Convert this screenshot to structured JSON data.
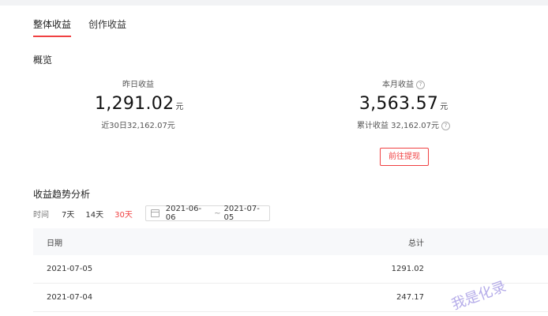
{
  "tabs": [
    {
      "label": "整体收益",
      "active": true
    },
    {
      "label": "创作收益",
      "active": false
    }
  ],
  "overview": {
    "title": "概览",
    "yesterday": {
      "label": "昨日收益",
      "value": "1,291.02",
      "unit": "元",
      "sub": "近30日32,162.07元"
    },
    "month": {
      "label": "本月收益",
      "value": "3,563.57",
      "unit": "元",
      "sub": "累计收益 32,162.07元",
      "help_icon": "question-circle-icon"
    },
    "withdraw_button": "前往提现"
  },
  "trend": {
    "title": "收益趋势分析",
    "time_label": "时间",
    "options": [
      {
        "label": "7天",
        "active": false
      },
      {
        "label": "14天",
        "active": false
      },
      {
        "label": "30天",
        "active": true
      }
    ],
    "date_start": "2021-06-06",
    "date_sep": "~",
    "date_end": "2021-07-05"
  },
  "table": {
    "headers": {
      "date": "日期",
      "total": "总计"
    },
    "rows": [
      {
        "date": "2021-07-05",
        "total": "1291.02"
      },
      {
        "date": "2021-07-04",
        "total": "247.17"
      }
    ]
  },
  "watermark": "我是化录",
  "colors": {
    "accent": "#f04142",
    "header_bg": "#f7f8fa"
  }
}
